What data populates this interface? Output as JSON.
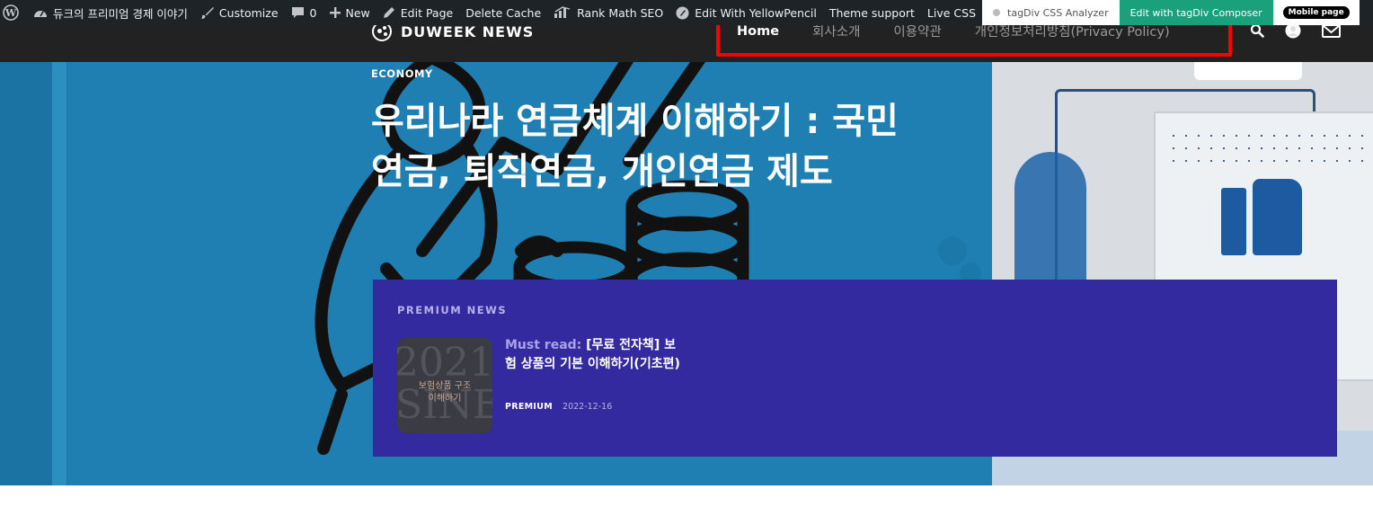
{
  "adminbar": {
    "site_name": "듀크의 프리미엄 경제 이야기",
    "customize": "Customize",
    "comments_count": "0",
    "new": "New",
    "edit_page": "Edit Page",
    "delete_cache": "Delete Cache",
    "rank_math": "Rank Math SEO",
    "yellowpencil": "Edit With YellowPencil",
    "theme_support": "Theme support",
    "live_css": "Live CSS",
    "css_analyzer": "tagDiv CSS Analyzer",
    "composer": "Edit with tagDiv Composer",
    "mobile_page": "Mobile page"
  },
  "header": {
    "logo_text": "DUWEEK NEWS",
    "nav": [
      "Home",
      "회사소개",
      "이용약관",
      "개인정보처리방침(Privacy Policy)"
    ],
    "icons": [
      "search-icon",
      "user-icon",
      "mail-icon"
    ]
  },
  "hero": {
    "category": "ECONOMY",
    "title": "우리나라 연금체계 이해하기 : 국민연금, 퇴직연금, 개인연금 제도"
  },
  "premium": {
    "label": "PREMIUM NEWS",
    "item": {
      "thumb_year": "2021",
      "thumb_word": "SINE",
      "thumb_line1": "보험상품 구조",
      "thumb_line2": "이해하기",
      "prefix": "Must read:",
      "title": "[무료 전자책] 보험 상품의 기본 이해하기(기초편)",
      "tag": "PREMIUM",
      "date": "2022-12-16"
    }
  },
  "colors": {
    "adminbar_bg": "#1d2327",
    "header_bg": "#222222",
    "hero_bg": "#1f7fb2",
    "premium_bg": "#342aa0",
    "highlight": "#ff0000",
    "composer_green": "#1aa07b"
  }
}
